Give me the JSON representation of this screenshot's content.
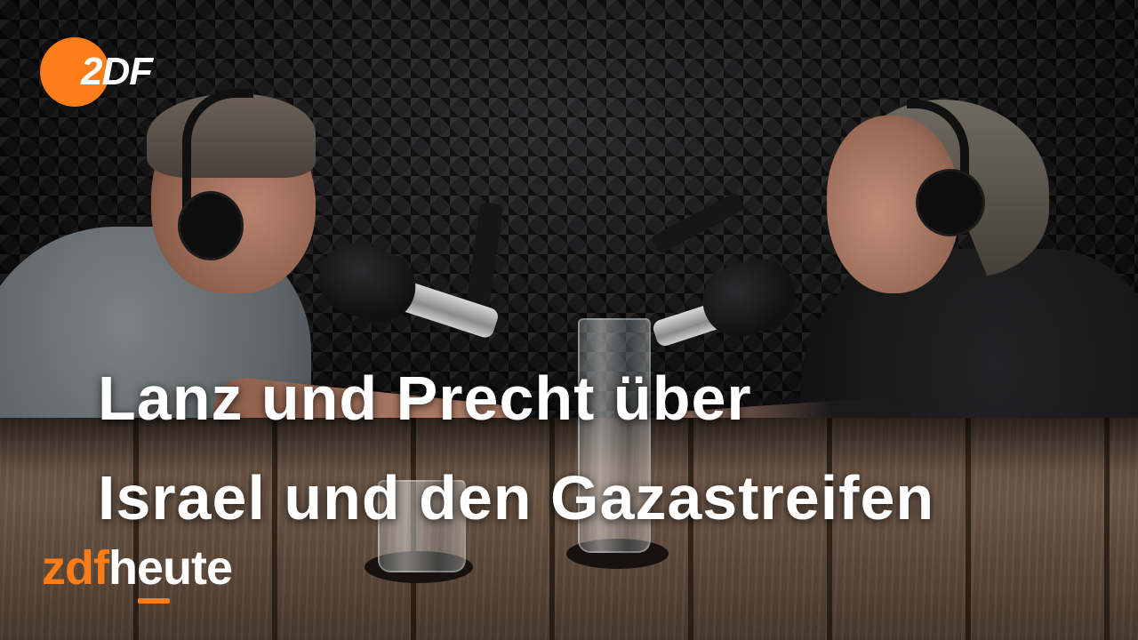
{
  "logo": {
    "text": "2DF",
    "accent_color": "#fa7d19"
  },
  "headline": {
    "line1": "Lanz und Precht über",
    "line2": "Israel und den Gazastreifen"
  },
  "brand": {
    "zdf": "zdf",
    "heute": "heute",
    "color": "#fa7d19"
  }
}
